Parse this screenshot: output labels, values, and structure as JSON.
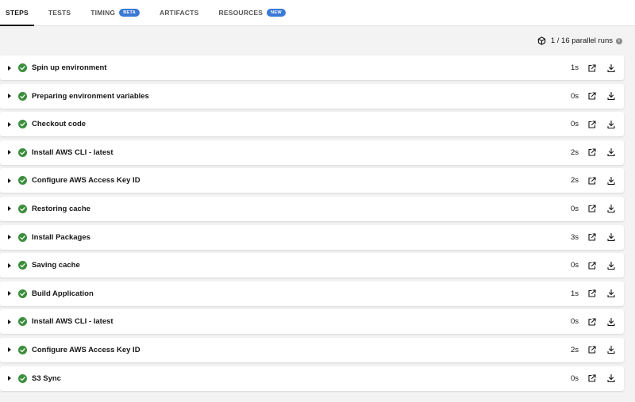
{
  "tabs": [
    {
      "label": "STEPS",
      "active": true,
      "badge": ""
    },
    {
      "label": "TESTS",
      "active": false,
      "badge": ""
    },
    {
      "label": "TIMING",
      "active": false,
      "badge": "BETA"
    },
    {
      "label": "ARTIFACTS",
      "active": false,
      "badge": ""
    },
    {
      "label": "RESOURCES",
      "active": false,
      "badge": "NEW"
    }
  ],
  "parallel": {
    "text": "1 / 16 parallel runs",
    "icon": "cube-icon",
    "info_icon": "info-icon"
  },
  "colors": {
    "success": "#3b8e3b",
    "badge": "#3b79d6",
    "active_tab": "#161616"
  },
  "steps": [
    {
      "name": "Spin up environment",
      "duration": "1s",
      "status": "success"
    },
    {
      "name": "Preparing environment variables",
      "duration": "0s",
      "status": "success"
    },
    {
      "name": "Checkout code",
      "duration": "0s",
      "status": "success"
    },
    {
      "name": "Install AWS CLI - latest",
      "duration": "2s",
      "status": "success"
    },
    {
      "name": "Configure AWS Access Key ID",
      "duration": "2s",
      "status": "success"
    },
    {
      "name": "Restoring cache",
      "duration": "0s",
      "status": "success"
    },
    {
      "name": "Install Packages",
      "duration": "3s",
      "status": "success"
    },
    {
      "name": "Saving cache",
      "duration": "0s",
      "status": "success"
    },
    {
      "name": "Build Application",
      "duration": "1s",
      "status": "success"
    },
    {
      "name": "Install AWS CLI - latest",
      "duration": "0s",
      "status": "success"
    },
    {
      "name": "Configure AWS Access Key ID",
      "duration": "2s",
      "status": "success"
    },
    {
      "name": "S3 Sync",
      "duration": "0s",
      "status": "success"
    }
  ]
}
